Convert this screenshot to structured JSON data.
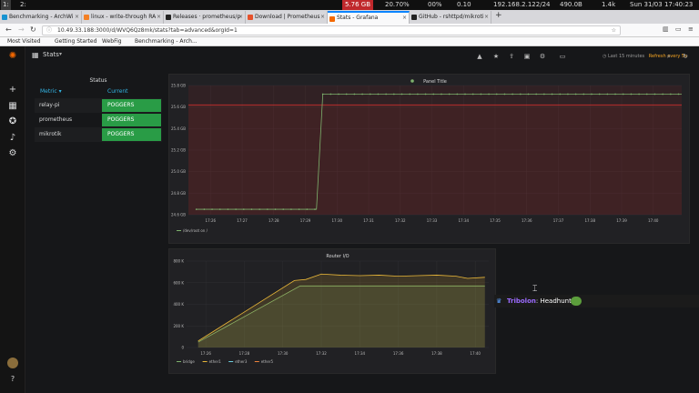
{
  "statusbar": {
    "workspaces": [
      "1:",
      "2:"
    ],
    "disk": "5.76 GB",
    "cpu": "20.70%",
    "mem_pct": "00%",
    "load": "0.10",
    "net": "192.168.2.122/24",
    "down": "490.0B",
    "up": "1.4k",
    "datetime": "Sun 31/03 17:40:23"
  },
  "browser": {
    "tabs": [
      {
        "label": "Benchmarking - ArchWi",
        "color": "#1793d1",
        "active": false
      },
      {
        "label": "linux - write-through RA",
        "color": "#f48024",
        "active": false
      },
      {
        "label": "Releases · prometheus/p",
        "color": "#222222",
        "active": false
      },
      {
        "label": "Download | Prometheus",
        "color": "#e6522c",
        "active": false
      },
      {
        "label": "Stats - Grafana",
        "color": "#f46800",
        "active": true
      },
      {
        "label": "GitHub - rshttpd/mikroti",
        "color": "#222222",
        "active": false
      }
    ],
    "url": "10.49.33.188:3000/d/WVQ6Qz8mk/stats?tab=advanced&orgId=1",
    "bookmarks": [
      "Most Visited",
      "Getting Started",
      "WebFig",
      "Benchmarking - Arch..."
    ]
  },
  "grafana": {
    "dashboard_title": "Stats",
    "time_range": "Last 15 minutes",
    "refresh": "Refresh every 5s",
    "status_panel": {
      "title": "Status",
      "col_metric": "Metric",
      "col_current": "Current",
      "rows": [
        {
          "metric": "relay-pi",
          "value": "POGGERS"
        },
        {
          "metric": "prometheus",
          "value": "POGGERS"
        },
        {
          "metric": "mikrotik",
          "value": "POGGERS"
        }
      ],
      "ok_color": "#299c46"
    }
  },
  "chart_data": [
    {
      "type": "line",
      "title": "Panel Title",
      "x": [
        "17:26",
        "17:27",
        "17:28",
        "17:29",
        "17:30",
        "17:31",
        "17:32",
        "17:33",
        "17:34",
        "17:35",
        "17:36",
        "17:37",
        "17:38",
        "17:39",
        "17:40"
      ],
      "yticks": [
        "24.6 GB",
        "24.8 GB",
        "25.0 GB",
        "25.2 GB",
        "25.4 GB",
        "25.6 GB",
        "25.8 GB"
      ],
      "ylim": [
        24.6,
        25.8
      ],
      "series": [
        {
          "name": "/dev/root on /",
          "color": "#7eb26d",
          "points": [
            [
              25.55,
              24.65
            ],
            [
              29.35,
              24.65
            ],
            [
              29.55,
              25.72
            ],
            [
              40.9,
              25.72
            ]
          ]
        }
      ],
      "threshold": 25.62,
      "legend": "bottom-left"
    },
    {
      "type": "area",
      "title": "Router I/O",
      "x": [
        "17:26",
        "17:28",
        "17:30",
        "17:32",
        "17:34",
        "17:36",
        "17:38",
        "17:40"
      ],
      "yticks": [
        "0",
        "200 K",
        "400 K",
        "600 K",
        "800 K"
      ],
      "ylim": [
        0,
        800
      ],
      "series": [
        {
          "name": "bridge",
          "color": "#7eb26d",
          "points": [
            [
              25.6,
              50
            ],
            [
              30.9,
              570
            ],
            [
              40.5,
              570
            ]
          ]
        },
        {
          "name": "ether1",
          "color": "#eab839",
          "points": [
            [
              25.6,
              60
            ],
            [
              30.6,
              620
            ],
            [
              31.2,
              630
            ],
            [
              32.0,
              680
            ],
            [
              33.0,
              670
            ],
            [
              34.0,
              665
            ],
            [
              35.0,
              670
            ],
            [
              36.0,
              660
            ],
            [
              37.0,
              665
            ],
            [
              38.0,
              670
            ],
            [
              39.0,
              660
            ],
            [
              39.6,
              640
            ],
            [
              40.5,
              650
            ]
          ]
        },
        {
          "name": "ether3",
          "color": "#6ed0e0",
          "points": []
        },
        {
          "name": "ether5",
          "color": "#ef843c",
          "points": []
        }
      ],
      "legend": "bottom-left"
    }
  ],
  "chat": {
    "user": "Tribolon",
    "message": "Headhunter"
  }
}
